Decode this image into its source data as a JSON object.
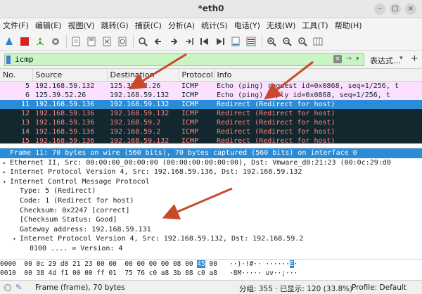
{
  "window": {
    "title": "*eth0",
    "minimize": "–",
    "maximize": "□",
    "close": "×"
  },
  "menu": [
    "文件(F)",
    "编辑(E)",
    "视图(V)",
    "跳转(G)",
    "捕获(C)",
    "分析(A)",
    "统计(S)",
    "电话(Y)",
    "无线(W)",
    "工具(T)",
    "帮助(H)"
  ],
  "toolbar": {
    "icons": [
      "shark-fin-icon",
      "stop-icon",
      "restart-icon",
      "options-gear-icon",
      "open-file-icon",
      "save-file-icon",
      "close-file-icon",
      "reload-icon",
      "find-icon",
      "go-back-icon",
      "go-forward-icon",
      "go-to-packet-icon",
      "first-packet-icon",
      "last-packet-icon",
      "autoscroll-icon",
      "colorize-icon",
      "zoom-in-icon",
      "zoom-out-icon",
      "zoom-reset-icon",
      "resize-columns-icon"
    ],
    "accent_colors": {
      "stop": "#d42424",
      "fin": "#2f7fd6",
      "restart": "#3aa63a"
    }
  },
  "filter": {
    "value": "icmp",
    "expression_label": "表达式…",
    "add_label": "+"
  },
  "packet_list": {
    "columns": [
      "No.",
      "Source",
      "Destination",
      "Protocol",
      "Info"
    ],
    "rows": [
      {
        "no": "5",
        "src": "192.168.59.132",
        "dst": "125.39.52.26",
        "proto": "ICMP",
        "info": "Echo (ping) request  id=0x0868, seq=1/256, t",
        "style": "light"
      },
      {
        "no": "6",
        "src": "125.39.52.26",
        "dst": "192.168.59.132",
        "proto": "ICMP",
        "info": "Echo (ping) reply    id=0x0868, seq=1/256, t",
        "style": "light"
      },
      {
        "no": "11",
        "src": "192.168.59.136",
        "dst": "192.168.59.132",
        "proto": "ICMP",
        "info": "Redirect             (Redirect for host)",
        "style": "selected"
      },
      {
        "no": "12",
        "src": "192.168.59.136",
        "dst": "192.168.59.132",
        "proto": "ICMP",
        "info": "Redirect             (Redirect for host)",
        "style": "dark"
      },
      {
        "no": "13",
        "src": "192.168.59.136",
        "dst": "192.168.59.2",
        "proto": "ICMP",
        "info": "Redirect             (Redirect for host)",
        "style": "dark"
      },
      {
        "no": "14",
        "src": "192.168.59.136",
        "dst": "192.168.59.2",
        "proto": "ICMP",
        "info": "Redirect             (Redirect for host)",
        "style": "dark"
      },
      {
        "no": "15",
        "src": "192.168.59.136",
        "dst": "192.168.59.132",
        "proto": "ICMP",
        "info": "Redirect             (Redirect for host)",
        "style": "dark"
      }
    ],
    "colors": {
      "light_bg": "#fce0ff",
      "dark_bg": "#12272e",
      "dark_fg": "#f78787",
      "selected_bg": "#2a8bd6"
    }
  },
  "details": [
    {
      "arrow": "",
      "text": "Frame 11: 70 bytes on wire (560 bits), 70 bytes captured (560 bits) on interface 0",
      "indent": 0,
      "selected": true
    },
    {
      "arrow": "▸",
      "text": "Ethernet II, Src: 00:00:00_00:00:00 (00:00:00:00:00:00), Dst: Vmware_d0:21:23 (00:0c:29:d0",
      "indent": 0,
      "selected": false
    },
    {
      "arrow": "▸",
      "text": "Internet Protocol Version 4, Src: 192.168.59.136, Dst: 192.168.59.132",
      "indent": 0,
      "selected": false
    },
    {
      "arrow": "▾",
      "text": "Internet Control Message Protocol",
      "indent": 0,
      "selected": false
    },
    {
      "arrow": "",
      "text": "Type: 5 (Redirect)",
      "indent": 1,
      "selected": false
    },
    {
      "arrow": "",
      "text": "Code: 1 (Redirect for host)",
      "indent": 1,
      "selected": false
    },
    {
      "arrow": "",
      "text": "Checksum: 0x2247 [correct]",
      "indent": 1,
      "selected": false
    },
    {
      "arrow": "",
      "text": "[Checksum Status: Good]",
      "indent": 1,
      "selected": false
    },
    {
      "arrow": "",
      "text": "Gateway address: 192.168.59.131",
      "indent": 1,
      "selected": false
    },
    {
      "arrow": "▾",
      "text": "Internet Protocol Version 4, Src: 192.168.59.132, Dst: 192.168.59.2",
      "indent": 1,
      "selected": false
    },
    {
      "arrow": "",
      "text": "0100 .... = Version: 4",
      "indent": 2,
      "selected": false
    }
  ],
  "bytes": [
    {
      "offset": "0000",
      "hex_pre": "00 0c 29 d0 21 23 00 00  00 00 00 00 08 00 ",
      "hex_hl": "45",
      "hex_post": " 00",
      "ascii_pre": "   ··)·!#·· ······",
      "ascii_hl": "E",
      "ascii_post": "·"
    },
    {
      "offset": "0010",
      "hex_pre": "00 38 4d f1 00 00 ff 01  75 76 c0 a8 3b 88 c0 a8",
      "hex_hl": "",
      "hex_post": "",
      "ascii_pre": "   ·8M····· uv··;···",
      "ascii_hl": "",
      "ascii_post": ""
    }
  ],
  "status": {
    "frame": "Frame (frame), 70 bytes",
    "packets": "分组: 355 · 已显示: 120 (33.8%)",
    "profile": "Profile: Default"
  }
}
